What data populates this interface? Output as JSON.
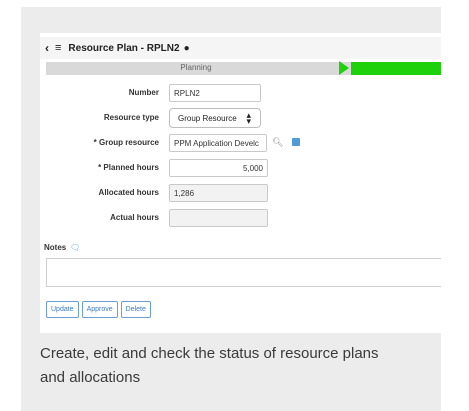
{
  "window": {
    "back_icon": "‹",
    "menu_icon": "≡",
    "title": "Resource Plan - RPLN2",
    "pin_icon": "●"
  },
  "progress": {
    "stage_label": "Planning",
    "done_color": "#1fd10a"
  },
  "form": {
    "number": {
      "label": "Number",
      "value": "RPLN2"
    },
    "resource_type": {
      "label": "Resource type",
      "value": "Group Resource"
    },
    "group_resource": {
      "label": "* Group resource",
      "value": "PPM Application Develc"
    },
    "planned_hours": {
      "label": "* Planned hours",
      "value": "5,000"
    },
    "allocated_hours": {
      "label": "Allocated hours",
      "value": "1,286"
    },
    "actual_hours": {
      "label": "Actual hours",
      "value": ""
    }
  },
  "notes": {
    "label": "Notes"
  },
  "buttons": {
    "update": "Update",
    "approve": "Approve",
    "delete": "Delete"
  },
  "caption": "Create, edit and check the status of resource plans and allocations"
}
